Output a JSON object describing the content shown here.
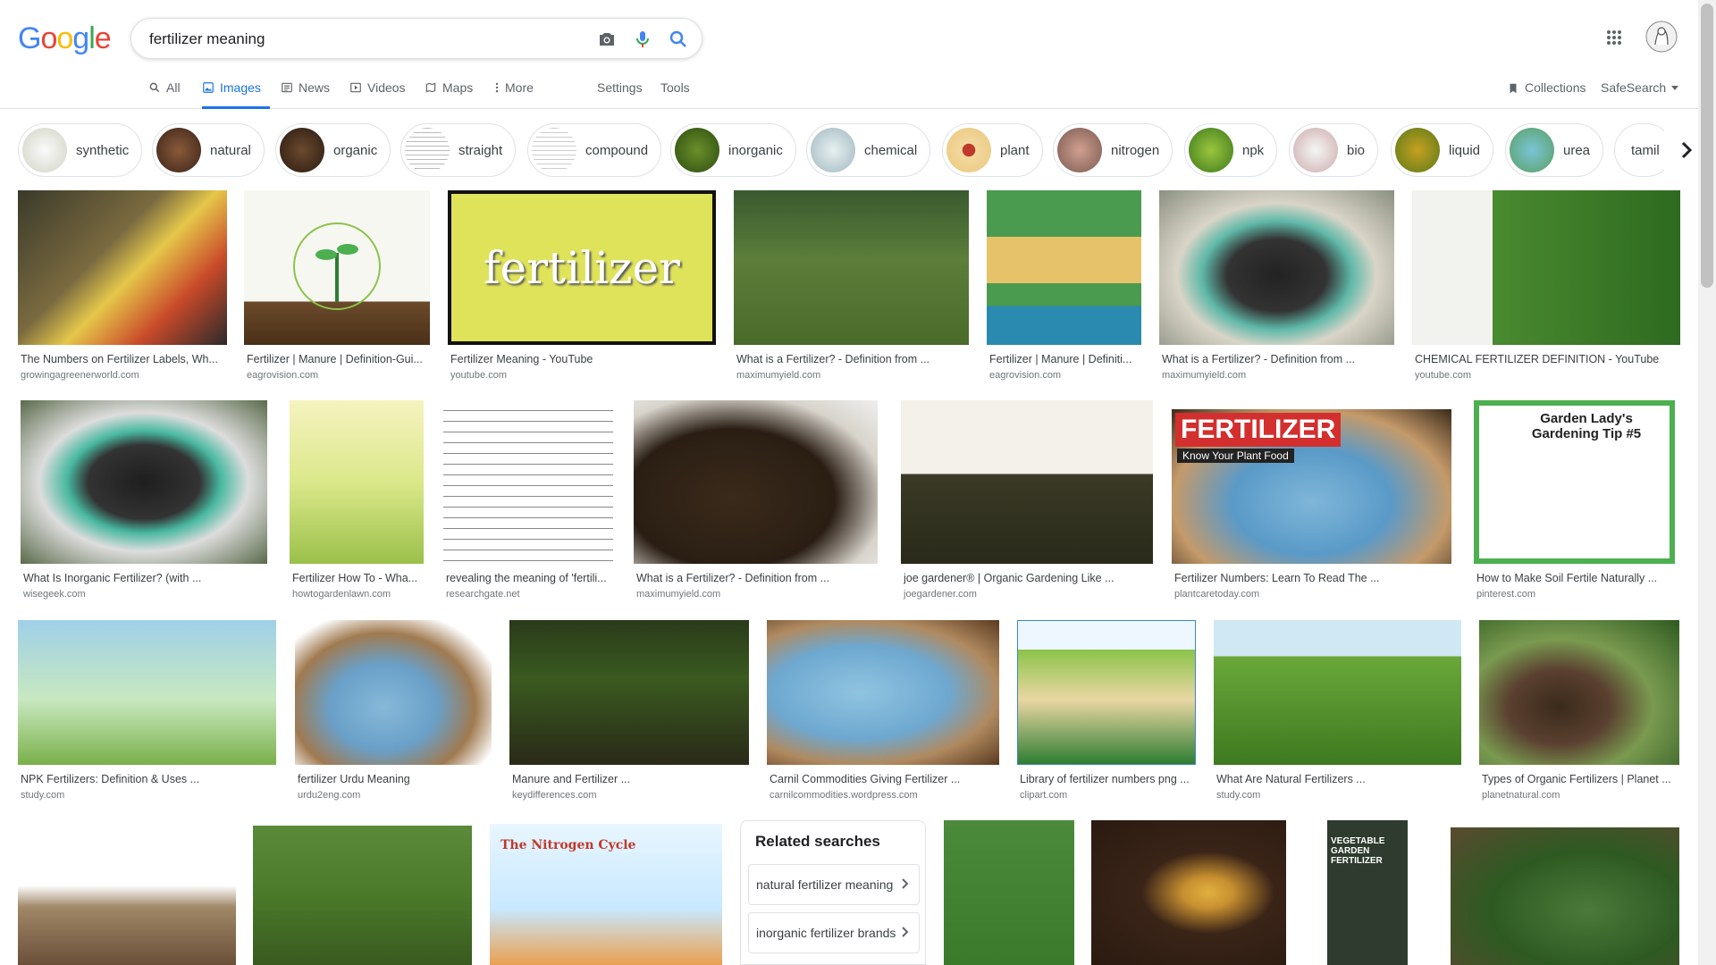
{
  "logo": {
    "letters": [
      "G",
      "o",
      "o",
      "g",
      "l",
      "e"
    ]
  },
  "search": {
    "query": "fertilizer meaning"
  },
  "tabs": [
    {
      "label": "All",
      "icon": "search-icon"
    },
    {
      "label": "Images",
      "icon": "image-icon"
    },
    {
      "label": "News",
      "icon": "news-icon"
    },
    {
      "label": "Videos",
      "icon": "video-icon"
    },
    {
      "label": "Maps",
      "icon": "map-icon"
    },
    {
      "label": "More",
      "icon": "more-icon"
    }
  ],
  "tools": {
    "settings": "Settings",
    "tools": "Tools",
    "collections": "Collections",
    "safesearch": "SafeSearch"
  },
  "chips": [
    "synthetic",
    "natural",
    "organic",
    "straight",
    "compound",
    "inorganic",
    "chemical",
    "plant",
    "nitrogen",
    "npk",
    "bio",
    "liquid",
    "urea",
    "tamil"
  ],
  "results": [
    {
      "caption": "The Numbers on Fertilizer Labels, Wh...",
      "domain": "growingagreenerworld.com"
    },
    {
      "caption": "Fertilizer | Manure | Definition-Gui...",
      "domain": "eagrovision.com"
    },
    {
      "caption": "Fertilizer Meaning - YouTube",
      "domain": "youtube.com",
      "overlay": "fertilizer"
    },
    {
      "caption": "What is a Fertilizer? - Definition from ...",
      "domain": "maximumyield.com"
    },
    {
      "caption": "Fertilizer | Manure | Definiti...",
      "domain": "eagrovision.com"
    },
    {
      "caption": "What is a Fertilizer? - Definition from ...",
      "domain": "maximumyield.com"
    },
    {
      "caption": "CHEMICAL FERTILIZER DEFINITION - YouTube",
      "domain": "youtube.com"
    },
    {
      "caption": "What Is Inorganic Fertilizer? (with ...",
      "domain": "wisegeek.com"
    },
    {
      "caption": "Fertilizer How To - Wha...",
      "domain": "howtogardenlawn.com"
    },
    {
      "caption": "revealing the meaning of 'fertili...",
      "domain": "researchgate.net"
    },
    {
      "caption": "What is a Fertilizer? - Definition from ...",
      "domain": "maximumyield.com"
    },
    {
      "caption": "joe gardener® | Organic Gardening Like ...",
      "domain": "joegardener.com"
    },
    {
      "caption": "Fertilizer Numbers: Learn To Read The ...",
      "domain": "plantcaretoday.com",
      "overlay": "FERTILIZER",
      "overlay2": "Know Your Plant Food"
    },
    {
      "caption": "How to Make Soil Fertile Naturally ...",
      "domain": "pinterest.com",
      "overlay": "Garden Lady's Gardening Tip #5"
    },
    {
      "caption": "NPK Fertilizers: Definition & Uses ...",
      "domain": "study.com"
    },
    {
      "caption": "fertilizer Urdu Meaning",
      "domain": "urdu2eng.com"
    },
    {
      "caption": "Manure and Fertilizer ...",
      "domain": "keydifferences.com"
    },
    {
      "caption": "Carnil Commodities Giving Fertilizer ...",
      "domain": "carnilcommodities.wordpress.com"
    },
    {
      "caption": "Library of fertilizer numbers png ...",
      "domain": "clipart.com"
    },
    {
      "caption": "What Are Natural Fertilizers ...",
      "domain": "study.com"
    },
    {
      "caption": "Types of Organic Fertilizers | Planet ...",
      "domain": "planetnatural.com"
    },
    {
      "caption": "",
      "domain": ""
    },
    {
      "caption": "",
      "domain": ""
    },
    {
      "caption": "",
      "domain": "",
      "overlay": "The Nitrogen Cycle"
    },
    {
      "caption": "",
      "domain": ""
    },
    {
      "caption": "",
      "domain": ""
    },
    {
      "caption": "",
      "domain": "",
      "overlay": "VEGETABLE GARDEN FERTILIZER"
    },
    {
      "caption": "",
      "domain": ""
    }
  ],
  "related": {
    "title": "Related searches",
    "items": [
      "natural fertilizer meaning",
      "inorganic fertilizer brands"
    ]
  },
  "colors": {
    "blue": "#1a73e8",
    "text": "#202124",
    "muted": "#70757a"
  }
}
